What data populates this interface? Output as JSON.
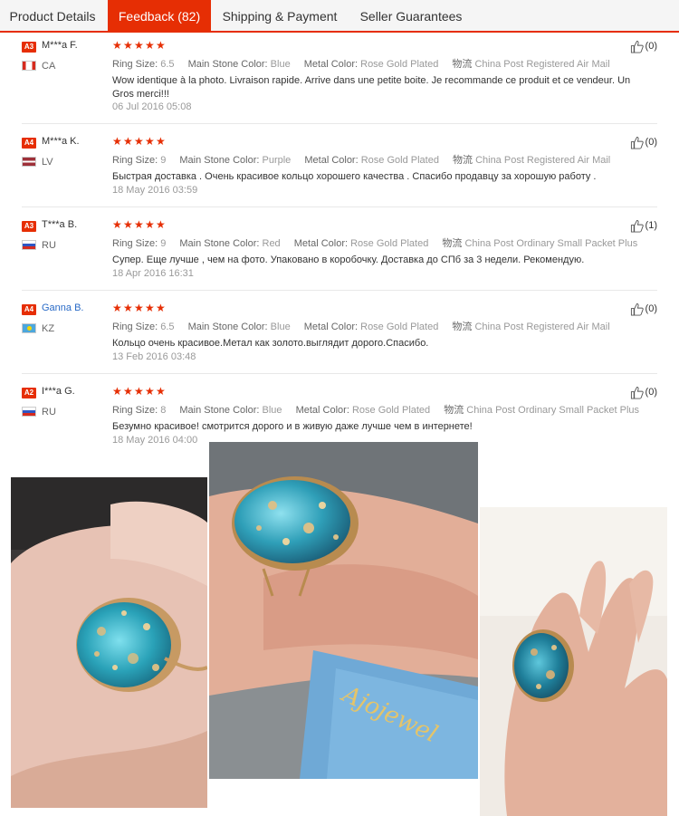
{
  "tabs": [
    {
      "label": "Product Details"
    },
    {
      "label": "Feedback (82)"
    },
    {
      "label": "Shipping & Payment"
    },
    {
      "label": "Seller Guarantees"
    }
  ],
  "labels": {
    "ring_size": "Ring Size:",
    "stone_color": "Main Stone Color:",
    "metal_color": "Metal Color:",
    "logistics": "物流"
  },
  "reviews": [
    {
      "level": "A3",
      "name": "M***a F.",
      "country": "CA",
      "ring_size": "6.5",
      "stone_color": "Blue",
      "metal_color": "Rose Gold Plated",
      "shipping": "China Post Registered Air Mail",
      "text": "Wow identique à la photo. Livraison rapide. Arrive dans une petite boite. Je recommande ce produit et ce vendeur. Un Gros merci!!!",
      "date": "06 Jul 2016 05:08",
      "helpful": "(0)"
    },
    {
      "level": "A4",
      "name": "M***a K.",
      "country": "LV",
      "ring_size": "9",
      "stone_color": "Purple",
      "metal_color": "Rose Gold Plated",
      "shipping": "China Post Registered Air Mail",
      "text": "Быстрая доставка . Очень красивое кольцо хорошего качества . Спасибо продавцу за хорошую работу .",
      "date": "18 May 2016 03:59",
      "helpful": "(0)"
    },
    {
      "level": "A3",
      "name": "T***a B.",
      "country": "RU",
      "ring_size": "9",
      "stone_color": "Red",
      "metal_color": "Rose Gold Plated",
      "shipping": "China Post Ordinary Small Packet Plus",
      "text": "Супер. Еще лучше , чем на фото. Упаковано в коробочку. Доставка до СПб за 3 недели. Рекомендую.",
      "date": "18 Apr 2016 16:31",
      "helpful": "(1)"
    },
    {
      "level": "A4",
      "name": "Ganna B.",
      "country": "KZ",
      "ring_size": "6.5",
      "stone_color": "Blue",
      "metal_color": "Rose Gold Plated",
      "shipping": "China Post Registered Air Mail",
      "text": "Кольцо очень красивое.Метал как золото.выглядит дорого.Спасибо.",
      "date": "13 Feb 2016 03:48",
      "helpful": "(0)"
    },
    {
      "level": "A2",
      "name": "I***a G.",
      "country": "RU",
      "ring_size": "8",
      "stone_color": "Blue",
      "metal_color": "Rose Gold Plated",
      "shipping": "China Post Ordinary Small Packet Plus",
      "text": "Безумно красивое! смотрится дорого и в живую даже лучше чем в интернете!",
      "date": "18 May 2016 04:00",
      "helpful": "(0)"
    }
  ],
  "photos": {
    "box_text": "Ajojewel"
  },
  "colors": {
    "accent": "#e62e04",
    "stone": "#2f9fb8",
    "gold": "#c9a060",
    "skin": "#e8b8a4"
  }
}
